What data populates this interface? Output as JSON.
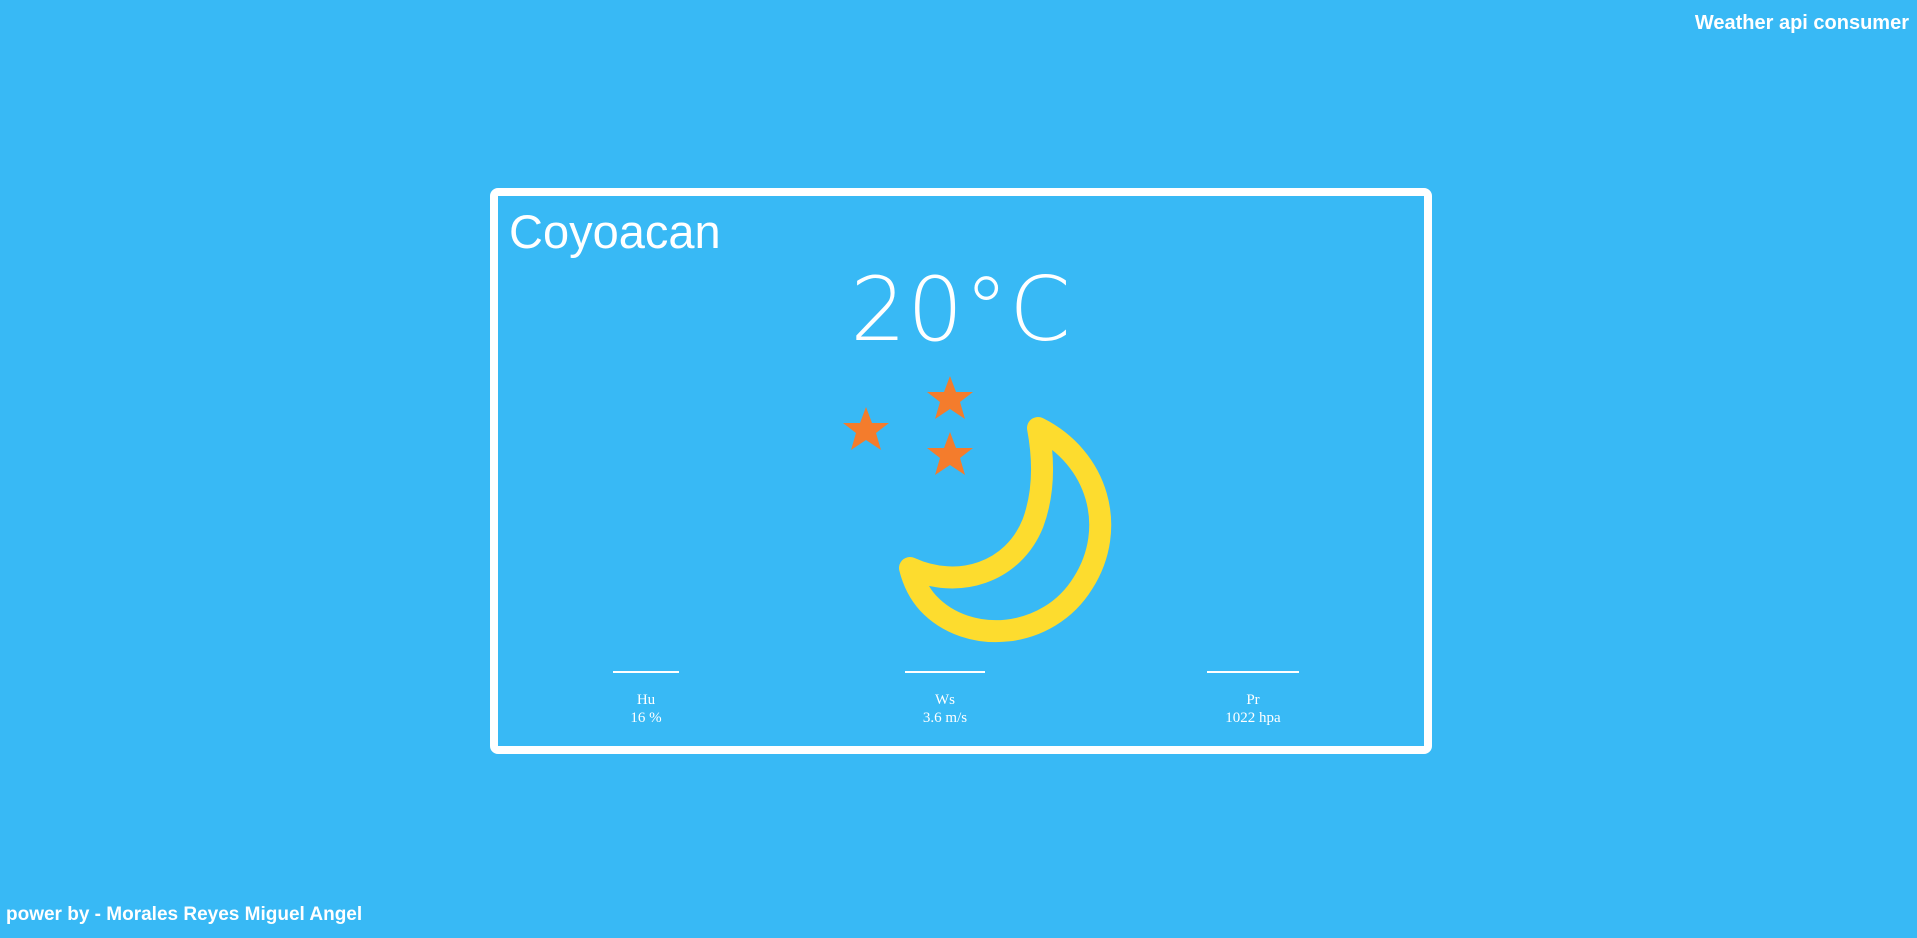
{
  "header": {
    "app_title": "Weather api consumer"
  },
  "weather": {
    "city": "Coyoacan",
    "temperature": "20°C",
    "condition_icon": "moon-stars-icon",
    "stats": [
      {
        "label": "Hu",
        "value": "16 %"
      },
      {
        "label": "Ws",
        "value": "3.6 m/s"
      },
      {
        "label": "Pr",
        "value": "1022 hpa"
      }
    ]
  },
  "footer": {
    "credit": "power by - Morales Reyes Miguel Angel"
  },
  "colors": {
    "background": "#38b9f5",
    "foreground": "#ffffff",
    "moon": "#fddc2e",
    "stars": "#f47c2c"
  }
}
